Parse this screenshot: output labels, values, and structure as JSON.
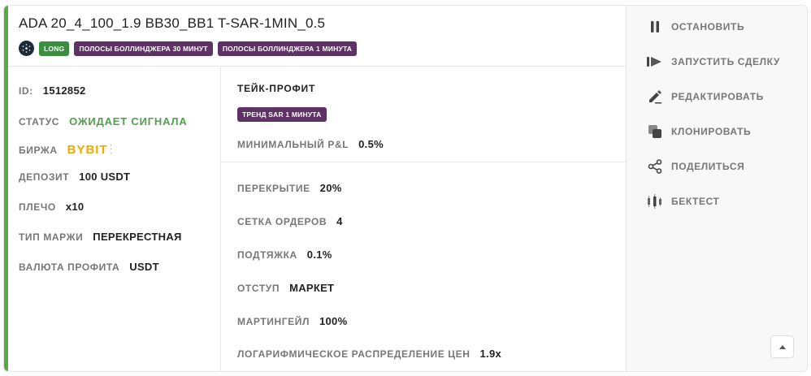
{
  "bot": {
    "title": "ADA 20_4_100_1.9 BB30_BB1 T-SAR-1MIN_0.5",
    "badges": {
      "direction": "LONG",
      "tag1": "ПОЛОСЫ БОЛЛИНДЖЕРА 30 МИНУТ",
      "tag2": "ПОЛОСЫ БОЛЛИНДЖЕРА 1 МИНУТА"
    },
    "coin_icon": "cardano-icon"
  },
  "details": {
    "id_label": "ID:",
    "id_value": "1512852",
    "status_label": "СТАТУС",
    "status_value": "ОЖИДАЕТ СИГНАЛА",
    "exchange_label": "БИРЖА",
    "exchange_logo_text": "BYBIT",
    "deposit_label": "ДЕПОЗИТ",
    "deposit_value": "100 USDT",
    "leverage_label": "ПЛЕЧО",
    "leverage_value": "x10",
    "margin_label": "ТИП МАРЖИ",
    "margin_value": "ПЕРЕКРЕСТНАЯ",
    "profit_currency_label": "ВАЛЮТА ПРОФИТА",
    "profit_currency_value": "USDT"
  },
  "take_profit": {
    "title": "ТЕЙК-ПРОФИТ",
    "badge": "ТРЕНД SAR 1 МИНУТА",
    "min_pnl_label": "МИНИМАЛЬНЫЙ P&L",
    "min_pnl_value": "0.5%"
  },
  "grid": {
    "overlap_label": "ПЕРЕКРЫТИЕ",
    "overlap_value": "20%",
    "orders_label": "СЕТКА ОРДЕРОВ",
    "orders_value": "4",
    "pullup_label": "ПОДТЯЖКА",
    "pullup_value": "0.1%",
    "indent_label": "ОТСТУП",
    "indent_value": "МАРКЕТ",
    "martingale_label": "МАРТИНГЕЙЛ",
    "martingale_value": "100%",
    "log_label": "ЛОГАРИФМИЧЕСКОЕ РАСПРЕДЕЛЕНИЕ ЦЕН",
    "log_value": "1.9x"
  },
  "actions": [
    {
      "label": "ОСТАНОВИТЬ",
      "icon": "pause-icon"
    },
    {
      "label": "ЗАПУСТИТЬ СДЕЛКУ",
      "icon": "play-icon"
    },
    {
      "label": "РЕДАКТИРОВАТЬ",
      "icon": "pencil-icon"
    },
    {
      "label": "КЛОНИРОВАТЬ",
      "icon": "copy-icon"
    },
    {
      "label": "ПОДЕЛИТЬСЯ",
      "icon": "share-icon"
    },
    {
      "label": "БЕКТЕСТ",
      "icon": "candles-icon"
    }
  ],
  "colors": {
    "accent": "#5aa84a",
    "status_green": "#4fa24a",
    "badge_purple": "#5e3264",
    "badge_green": "#3a8f3f",
    "bybit_gold": "#f2a900"
  }
}
